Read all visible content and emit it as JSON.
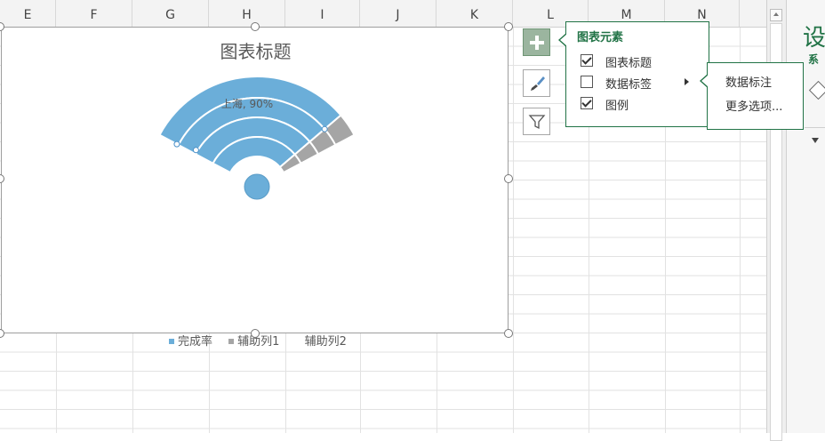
{
  "columns": [
    "E",
    "F",
    "G",
    "H",
    "I",
    "J",
    "K",
    "L",
    "M",
    "N"
  ],
  "chart": {
    "title": "图表标题",
    "data_label": "上海, 90%",
    "legend": [
      {
        "label": "完成率",
        "color": "#6baed9"
      },
      {
        "label": "辅助列1",
        "color": "#a5a5a5"
      },
      {
        "label": "辅助列2",
        "color": ""
      }
    ]
  },
  "chart_data": {
    "type": "pie",
    "title": "图表标题",
    "series": [
      {
        "name": "完成率",
        "values": [
          90
        ]
      },
      {
        "name": "辅助列1",
        "values": [
          10
        ]
      },
      {
        "name": "辅助列2",
        "values": []
      }
    ],
    "data_labels": [
      "上海, 90%"
    ],
    "legend": "bottom"
  },
  "chart_buttons": {
    "add_elements_icon": "plus-icon",
    "styles_icon": "brush-icon",
    "filter_icon": "filter-icon"
  },
  "popup": {
    "header": "图表元素",
    "items": [
      {
        "label": "图表标题",
        "checked": true
      },
      {
        "label": "数据标签",
        "checked": false,
        "has_submenu": true
      },
      {
        "label": "图例",
        "checked": true
      }
    ]
  },
  "submenu": {
    "items": [
      "数据标注",
      "更多选项..."
    ]
  },
  "side_panel": {
    "title": "设",
    "subtitle": "系"
  },
  "colors": {
    "accent": "#217346",
    "series1": "#6baed9",
    "series2": "#a5a5a5"
  }
}
